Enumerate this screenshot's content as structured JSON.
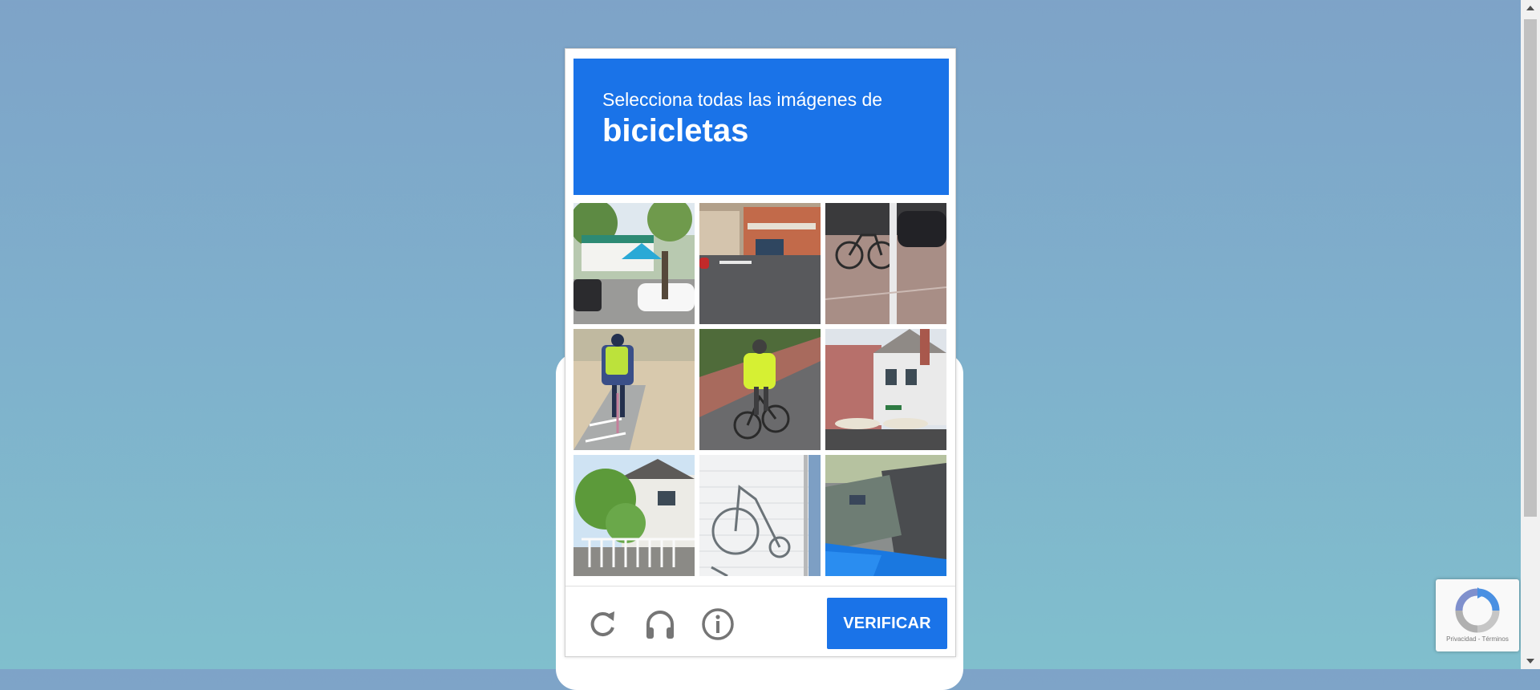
{
  "challenge": {
    "instruction": "Selecciona todas las imágenes de",
    "target": "bicicletas"
  },
  "grid": {
    "tiles": [
      {
        "subject": "street corner with tent and cars"
      },
      {
        "subject": "street intersection with buildings"
      },
      {
        "subject": "bicycle parked by pole"
      },
      {
        "subject": "cyclist with backpack on path"
      },
      {
        "subject": "cyclist in yellow jacket"
      },
      {
        "subject": "brick building with umbrellas"
      },
      {
        "subject": "house with tree and fence"
      },
      {
        "subject": "bicycle mural on wall"
      },
      {
        "subject": "road with blue tarp"
      }
    ]
  },
  "footer": {
    "reload_icon": "reload-icon",
    "audio_icon": "headphones-icon",
    "info_icon": "info-icon",
    "verify_label": "VERIFICAR"
  },
  "badge": {
    "legal": "Privacidad - Términos"
  },
  "colors": {
    "accent": "#1a73e8",
    "background_top": "#7ea3c8",
    "background_bottom": "#80bfcd"
  }
}
